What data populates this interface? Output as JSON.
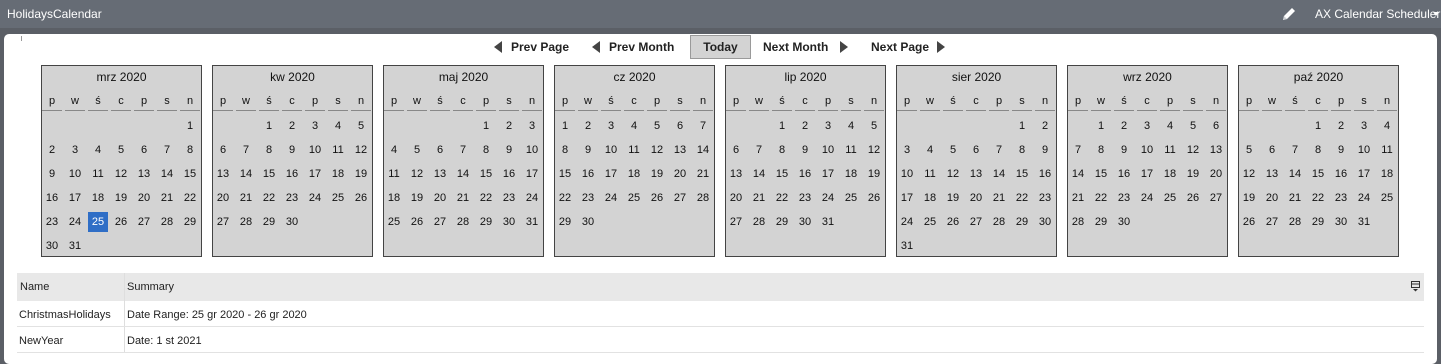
{
  "window": {
    "title": "HolidaysCalendar",
    "view_label": "AX Calendar Scheduler"
  },
  "nav": {
    "prev_page": "Prev Page",
    "prev_month": "Prev Month",
    "today": "Today",
    "next_month": "Next Month",
    "next_page": "Next Page"
  },
  "weekday_headers": [
    "p",
    "w",
    "ś",
    "c",
    "p",
    "s",
    "n"
  ],
  "selected_color": "#2f6ec6",
  "months": [
    {
      "title": "mrz 2020",
      "first_weekday": 6,
      "days": 31,
      "selected": 25
    },
    {
      "title": "kw 2020",
      "first_weekday": 2,
      "days": 30
    },
    {
      "title": "maj 2020",
      "first_weekday": 4,
      "days": 31
    },
    {
      "title": "cz 2020",
      "first_weekday": 0,
      "days": 30
    },
    {
      "title": "lip 2020",
      "first_weekday": 2,
      "days": 31
    },
    {
      "title": "sier 2020",
      "first_weekday": 5,
      "days": 31
    },
    {
      "title": "wrz 2020",
      "first_weekday": 1,
      "days": 30
    },
    {
      "title": "paź 2020",
      "first_weekday": 3,
      "days": 31
    }
  ],
  "table": {
    "columns": [
      "Name",
      "Summary"
    ],
    "rows": [
      {
        "name": "ChristmasHolidays",
        "summary": "Date Range: 25 gr 2020 - 26 gr 2020"
      },
      {
        "name": "NewYear",
        "summary": "Date: 1 st 2021"
      }
    ]
  },
  "icons": {
    "edit": "pencil-icon",
    "dropdown": "chevron-down-icon",
    "table_menu": "table-options-icon"
  }
}
